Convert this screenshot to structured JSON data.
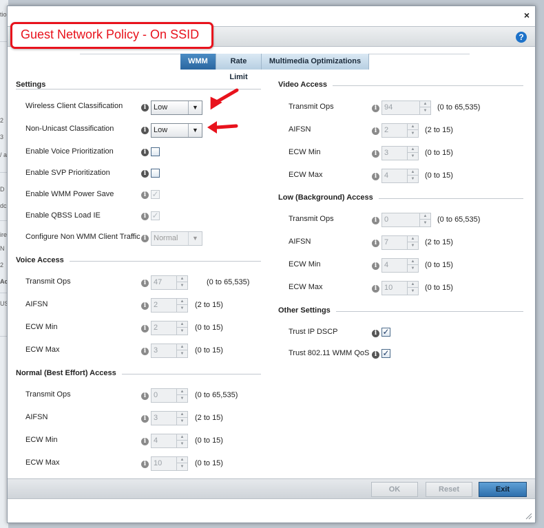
{
  "background": {
    "fragments": [
      "tio",
      "2",
      "3",
      "/ a",
      "D",
      "dc",
      "ire",
      "N",
      "2",
      "Ac",
      "US"
    ]
  },
  "dialog": {
    "close_label": "×",
    "title_callout": "Guest Network Policy - On SSID",
    "help_label": "?",
    "tabs": [
      {
        "label": "WMM",
        "active": true
      },
      {
        "label": "Rate Limit",
        "active": false
      },
      {
        "label": "Multimedia Optimizations",
        "active": false
      }
    ]
  },
  "settings": {
    "heading": "Settings",
    "wireless_client_classification": {
      "label": "Wireless Client Classification",
      "value": "Low"
    },
    "non_unicast_classification": {
      "label": "Non-Unicast Classification",
      "value": "Low"
    },
    "enable_voice_prioritization": {
      "label": "Enable Voice Prioritization",
      "checked": false
    },
    "enable_svp_prioritization": {
      "label": "Enable SVP Prioritization",
      "checked": false
    },
    "enable_wmm_power_save": {
      "label": "Enable WMM Power Save",
      "checked": true
    },
    "enable_qbss_load_ie": {
      "label": "Enable QBSS Load IE",
      "checked": true
    },
    "configure_non_wmm": {
      "label": "Configure Non WMM Client Traffic",
      "value": "Normal"
    }
  },
  "voice_access": {
    "heading": "Voice Access",
    "transmit_ops": {
      "label": "Transmit Ops",
      "value": "47",
      "range": "(0 to 65,535)"
    },
    "aifsn": {
      "label": "AIFSN",
      "value": "2",
      "range": "(2 to 15)"
    },
    "ecw_min": {
      "label": "ECW Min",
      "value": "2",
      "range": "(0 to 15)"
    },
    "ecw_max": {
      "label": "ECW Max",
      "value": "3",
      "range": "(0 to 15)"
    }
  },
  "normal_access": {
    "heading": "Normal (Best Effort) Access",
    "transmit_ops": {
      "label": "Transmit Ops",
      "value": "0",
      "range": "(0 to 65,535)"
    },
    "aifsn": {
      "label": "AIFSN",
      "value": "3",
      "range": "(2 to 15)"
    },
    "ecw_min": {
      "label": "ECW Min",
      "value": "4",
      "range": "(0 to 15)"
    },
    "ecw_max": {
      "label": "ECW Max",
      "value": "10",
      "range": "(0 to 15)"
    }
  },
  "video_access": {
    "heading": "Video Access",
    "transmit_ops": {
      "label": "Transmit Ops",
      "value": "94",
      "range": "(0 to 65,535)"
    },
    "aifsn": {
      "label": "AIFSN",
      "value": "2",
      "range": "(2 to 15)"
    },
    "ecw_min": {
      "label": "ECW Min",
      "value": "3",
      "range": "(0 to 15)"
    },
    "ecw_max": {
      "label": "ECW Max",
      "value": "4",
      "range": "(0 to 15)"
    }
  },
  "low_access": {
    "heading": "Low (Background) Access",
    "transmit_ops": {
      "label": "Transmit Ops",
      "value": "0",
      "range": "(0 to 65,535)"
    },
    "aifsn": {
      "label": "AIFSN",
      "value": "7",
      "range": "(2 to 15)"
    },
    "ecw_min": {
      "label": "ECW Min",
      "value": "4",
      "range": "(0 to 15)"
    },
    "ecw_max": {
      "label": "ECW Max",
      "value": "10",
      "range": "(0 to 15)"
    }
  },
  "other_settings": {
    "heading": "Other Settings",
    "trust_ip_dscp": {
      "label": "Trust IP DSCP",
      "checked": true
    },
    "trust_wmm_qos": {
      "label": "Trust 802.11 WMM QoS",
      "checked": true
    }
  },
  "footer": {
    "ok_label": "OK",
    "reset_label": "Reset",
    "exit_label": "Exit"
  },
  "colors": {
    "accent": "#2a66a0",
    "callout": "#e8121c",
    "help": "#1d72c9"
  },
  "icons": {
    "info": "info-icon",
    "help": "help-icon",
    "close": "close-icon",
    "dropdown": "chevron-down-icon",
    "annotation": "red-arrow-icon"
  }
}
